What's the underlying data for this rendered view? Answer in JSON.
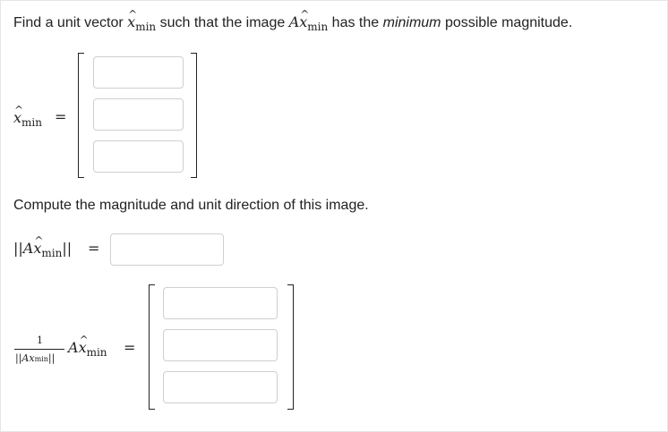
{
  "question": {
    "part1_before": "Find a unit vector ",
    "part1_var": "x",
    "part1_sub": "min",
    "part1_mid": " such that the image ",
    "part1_A": "A",
    "part1_x": "x",
    "part1_sub2": "min",
    "part1_after1": " has the ",
    "part1_emph": "minimum",
    "part1_after2": " possible magnitude."
  },
  "xmin_block": {
    "var": "x",
    "sub": "min",
    "equals": "="
  },
  "question2": {
    "text": "Compute the magnitude and unit direction of this image."
  },
  "norm_block": {
    "open": "||",
    "A": "A",
    "x": "x",
    "sub": "min",
    "close": "||",
    "equals": "="
  },
  "unit_block": {
    "num": "1",
    "den_open": "||",
    "den_A": "A",
    "den_x": "x",
    "den_sub": "min",
    "den_close": "||",
    "A": "A",
    "x": "x",
    "sub": "min",
    "equals": "="
  },
  "inputs": {
    "xmin_1": "",
    "xmin_2": "",
    "xmin_3": "",
    "norm": "",
    "unit_1": "",
    "unit_2": "",
    "unit_3": ""
  }
}
